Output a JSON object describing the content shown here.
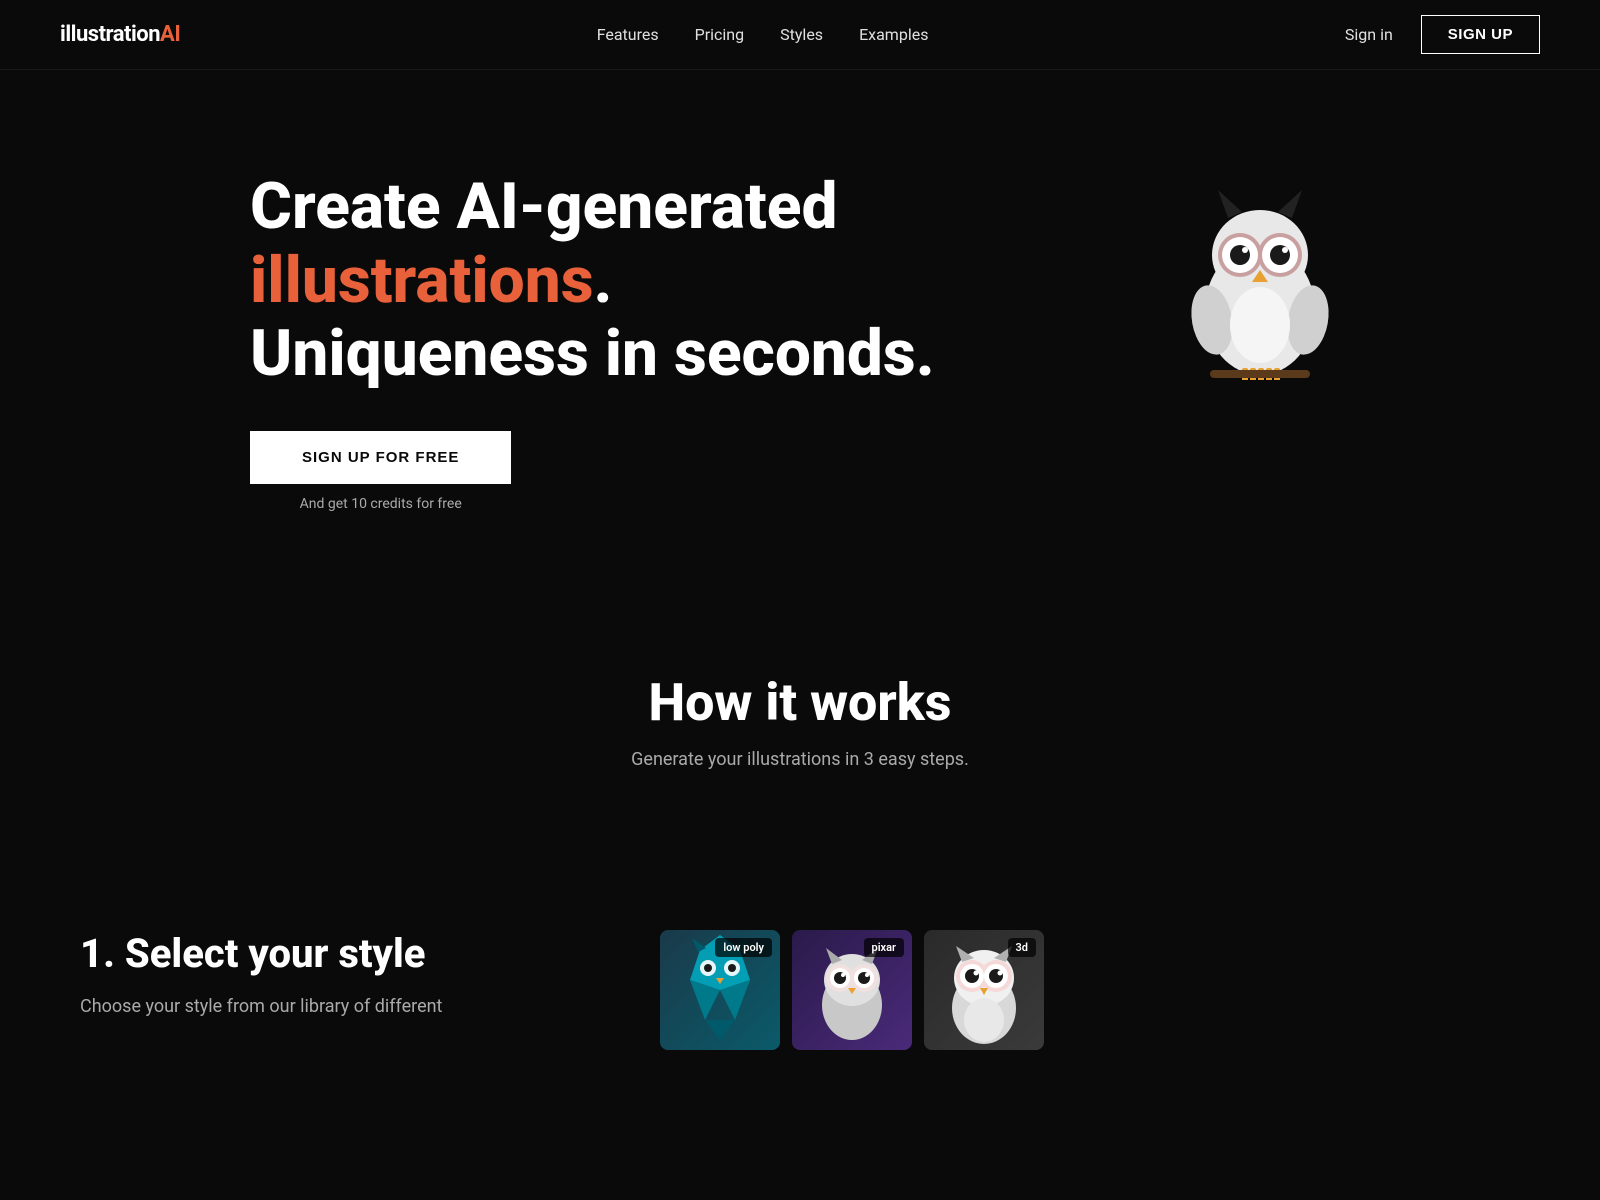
{
  "nav": {
    "logo_white": "illustration",
    "logo_orange": "AI",
    "links": [
      {
        "label": "Features",
        "href": "#"
      },
      {
        "label": "Pricing",
        "href": "#"
      },
      {
        "label": "Styles",
        "href": "#"
      },
      {
        "label": "Examples",
        "href": "#"
      }
    ],
    "sign_in": "Sign in",
    "signup": "SIGN UP"
  },
  "hero": {
    "title_part1": "Create AI-generated ",
    "title_highlight": "illustrations",
    "title_part2": ".",
    "title_line2": "Uniqueness in seconds.",
    "cta_button": "SIGN UP FOR FREE",
    "cta_subtext": "And get 10 credits for free"
  },
  "how_it_works": {
    "heading": "How it works",
    "subtitle": "Generate your illustrations in 3 easy steps."
  },
  "step1": {
    "number_title": "1. Select your style",
    "description": "Choose your style from our library of different",
    "styles": [
      {
        "label": "low poly",
        "bg": "card-lowpoly"
      },
      {
        "label": "pixar",
        "bg": "card-pixar"
      },
      {
        "label": "3d",
        "bg": "card-3d"
      }
    ]
  }
}
